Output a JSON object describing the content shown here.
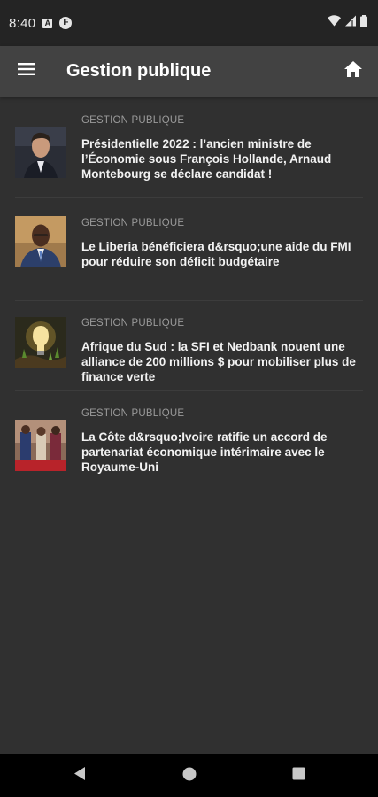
{
  "status_bar": {
    "time": "8:40",
    "notif_a": "A",
    "notif_f": "F"
  },
  "app_bar": {
    "title": "Gestion publique",
    "menu_icon": "hamburger-menu-icon",
    "home_icon": "home-icon"
  },
  "articles": [
    {
      "category": "GESTION PUBLIQUE",
      "title": "Présidentielle 2022 : l’ancien ministre de l’Économie sous François Hollande, Arnaud Montebourg se déclare candidat !"
    },
    {
      "category": "GESTION PUBLIQUE",
      "title": "Le Liberia bénéficiera d&rsquo;une aide du FMI pour réduire son déficit budgétaire"
    },
    {
      "category": "GESTION PUBLIQUE",
      "title": "Afrique du Sud : la SFI et Nedbank nouent une alliance de 200 millions $ pour mobiliser plus de finance verte"
    },
    {
      "category": "GESTION PUBLIQUE",
      "title": "La Côte d&rsquo;Ivoire ratifie un accord de partenariat économique intérimaire avec le Royaume-Uni"
    }
  ],
  "colors": {
    "status_bg": "#242424",
    "app_bar_bg": "#424242",
    "page_bg": "#303030",
    "category_text": "#9a9a9a"
  }
}
